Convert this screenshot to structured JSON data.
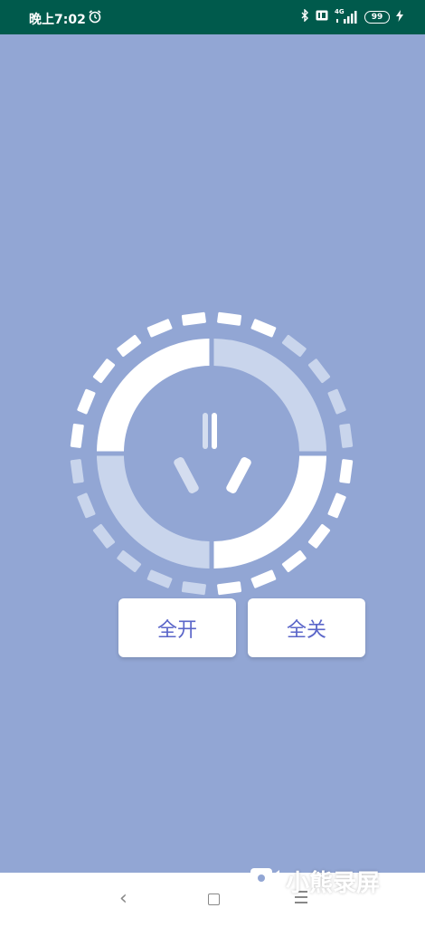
{
  "status_bar": {
    "time": "晚上7:02",
    "network": "4G",
    "battery": "99"
  },
  "dial": {
    "icon": "power-socket-icon",
    "colors": {
      "active": "#ffffff",
      "inactive": "#c9d5ec",
      "background": "#92a6d4"
    }
  },
  "buttons": {
    "all_on": "全开",
    "all_off": "全关"
  },
  "nav": {
    "back_icon": "back-icon",
    "home_icon": "home-icon",
    "menu_icon": "menu-icon"
  },
  "watermark": {
    "text": "小熊录屏"
  }
}
